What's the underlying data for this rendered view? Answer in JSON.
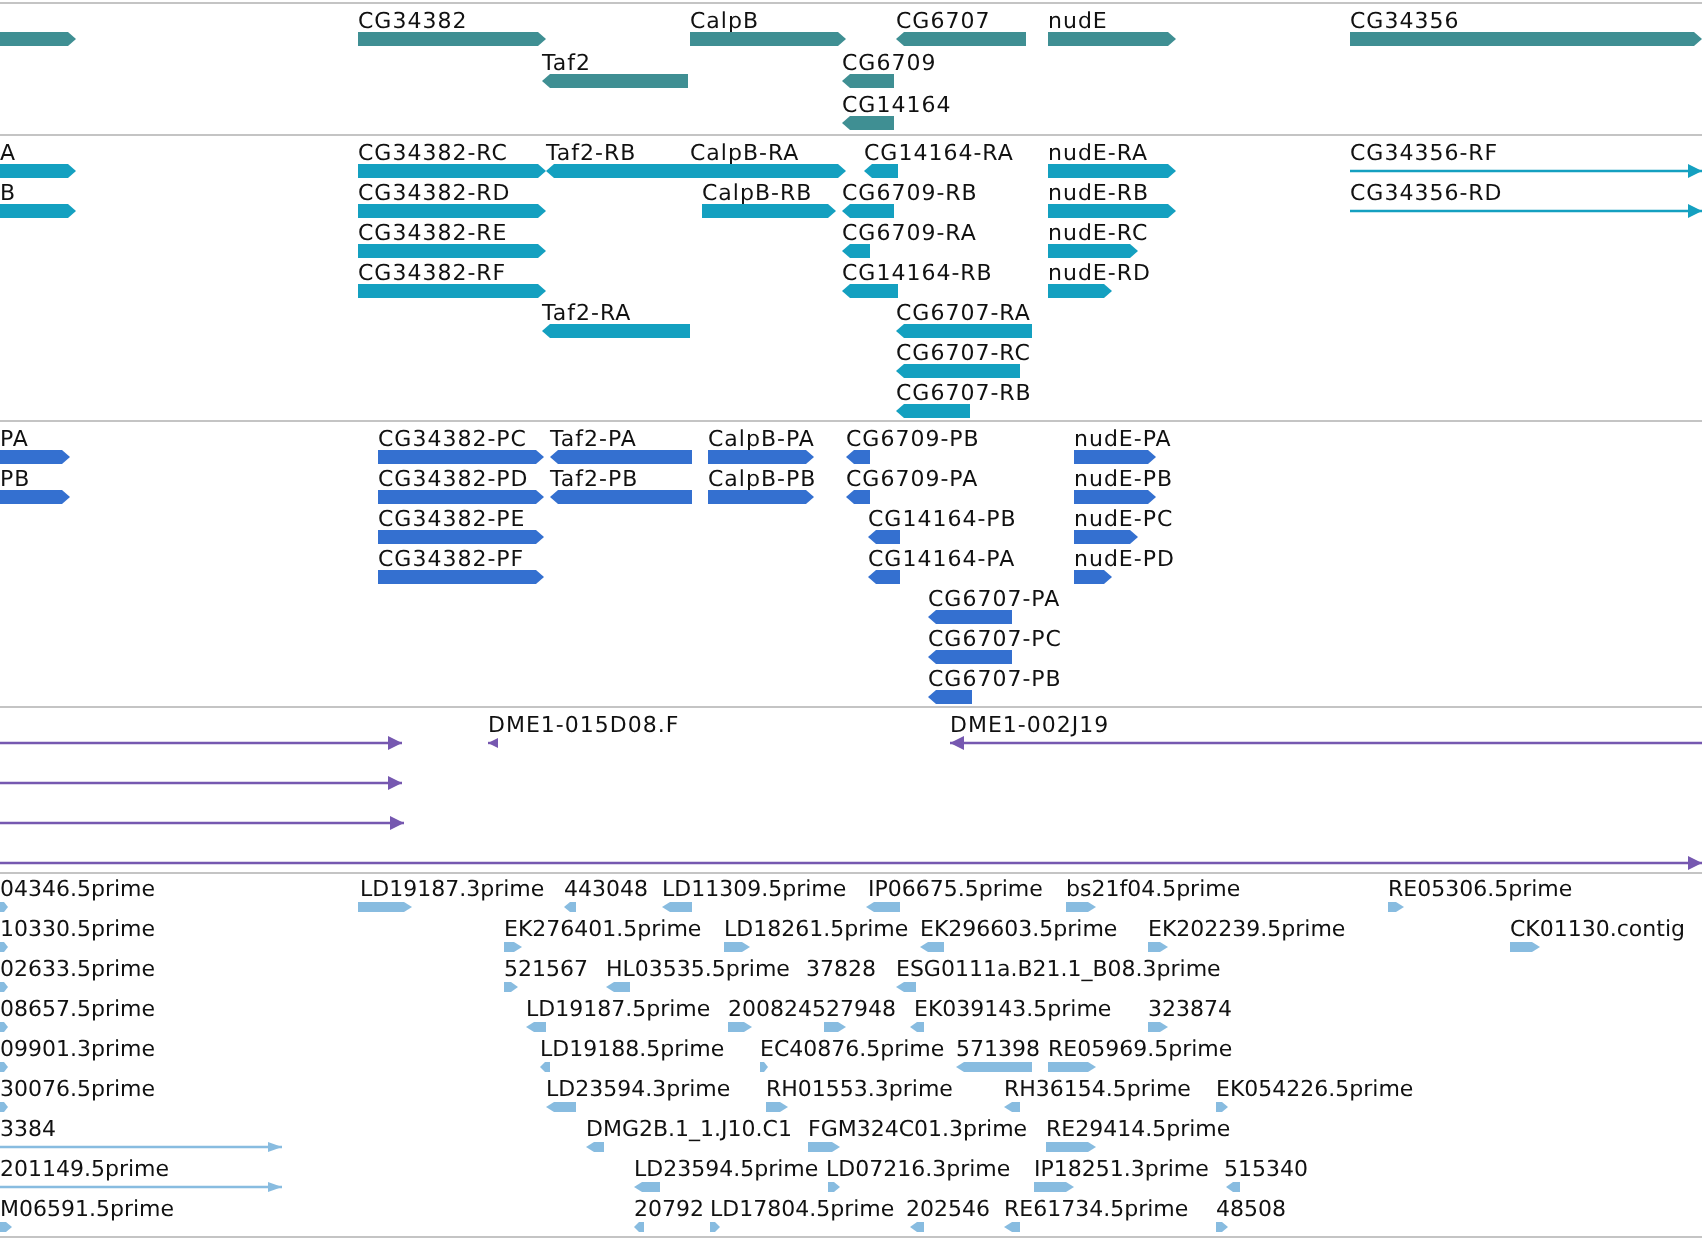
{
  "tracks": [
    {
      "kind": "gene",
      "color": "#3f8f93",
      "rows": [
        {
          "features": [
            {
              "reverse": false
            },
            {
              "label": "CG34382",
              "reverse": false
            },
            {
              "label": "CalpB",
              "reverse": false
            },
            {
              "label": "CG6707",
              "reverse": true
            },
            {
              "label": "nudE",
              "reverse": false
            },
            {
              "label": "CG34356",
              "reverse": false
            }
          ]
        },
        {
          "features": [
            {
              "label": "Taf2",
              "reverse": true
            },
            {
              "label": "CG6709",
              "reverse": true
            }
          ]
        },
        {
          "features": [
            {
              "label": "CG14164",
              "reverse": true
            }
          ]
        }
      ]
    },
    {
      "kind": "transcript",
      "color": "#14a0c0",
      "rows": [
        {
          "features": [
            {
              "label": "A",
              "reverse": false
            },
            {
              "label": "CG34382-RC",
              "reverse": false
            },
            {
              "label": "Taf2-RB",
              "reverse": true
            },
            {
              "label": "CalpB-RA",
              "reverse": false
            },
            {
              "label": "CG14164-RA",
              "reverse": true
            },
            {
              "label": "nudE-RA",
              "reverse": false
            },
            {
              "label": "CG34356-RF",
              "reverse": false
            }
          ]
        },
        {
          "features": [
            {
              "label": "B",
              "reverse": false
            },
            {
              "label": "CG34382-RD",
              "reverse": false
            },
            {
              "label": "CalpB-RB",
              "reverse": false
            },
            {
              "label": "CG6709-RB",
              "reverse": true
            },
            {
              "label": "nudE-RB",
              "reverse": false
            },
            {
              "label": "CG34356-RD",
              "reverse": false
            }
          ]
        },
        {
          "features": [
            {
              "label": "CG34382-RE",
              "reverse": false
            },
            {
              "label": "CG6709-RA",
              "reverse": true
            },
            {
              "label": "nudE-RC",
              "reverse": false
            }
          ]
        },
        {
          "features": [
            {
              "label": "CG34382-RF",
              "reverse": false
            },
            {
              "label": "CG14164-RB",
              "reverse": true
            },
            {
              "label": "nudE-RD",
              "reverse": false
            }
          ]
        },
        {
          "features": [
            {
              "label": "Taf2-RA",
              "reverse": true
            },
            {
              "label": "CG6707-RA",
              "reverse": true
            }
          ]
        },
        {
          "features": [
            {
              "label": "CG6707-RC",
              "reverse": true
            }
          ]
        },
        {
          "features": [
            {
              "label": "CG6707-RB",
              "reverse": true
            }
          ]
        }
      ]
    },
    {
      "kind": "protein",
      "color": "#3470d0",
      "rows": [
        {
          "features": [
            {
              "label": "PA",
              "reverse": false
            },
            {
              "label": "CG34382-PC",
              "reverse": false
            },
            {
              "label": "Taf2-PA",
              "reverse": true
            },
            {
              "label": "CalpB-PA",
              "reverse": false
            },
            {
              "label": "CG6709-PB",
              "reverse": true
            },
            {
              "label": "nudE-PA",
              "reverse": false
            }
          ]
        },
        {
          "features": [
            {
              "label": "PB",
              "reverse": false
            },
            {
              "label": "CG34382-PD",
              "reverse": false
            },
            {
              "label": "Taf2-PB",
              "reverse": true
            },
            {
              "label": "CalpB-PB",
              "reverse": false
            },
            {
              "label": "CG6709-PA",
              "reverse": true
            },
            {
              "label": "nudE-PB",
              "reverse": false
            }
          ]
        },
        {
          "features": [
            {
              "label": "CG34382-PE",
              "reverse": false
            },
            {
              "label": "CG14164-PB",
              "reverse": true
            },
            {
              "label": "nudE-PC",
              "reverse": false
            }
          ]
        },
        {
          "features": [
            {
              "label": "CG34382-PF",
              "reverse": false
            },
            {
              "label": "CG14164-PA",
              "reverse": true
            },
            {
              "label": "nudE-PD",
              "reverse": false
            }
          ]
        },
        {
          "features": [
            {
              "label": "CG6707-PA",
              "reverse": true
            }
          ]
        },
        {
          "features": [
            {
              "label": "CG6707-PC",
              "reverse": true
            }
          ]
        },
        {
          "features": [
            {
              "label": "CG6707-PB",
              "reverse": true
            }
          ]
        }
      ]
    },
    {
      "kind": "clone",
      "color": "#7658b0",
      "rows": [
        {
          "features": [
            {
              "reverse": false
            },
            {
              "label": "DME1-015D08.F",
              "reverse": true
            },
            {
              "label": "DME1-002J19",
              "reverse": true
            }
          ]
        },
        {
          "features": [
            {
              "reverse": false
            }
          ]
        },
        {
          "features": [
            {
              "reverse": false
            }
          ]
        },
        {
          "features": [
            {
              "reverse": false
            }
          ]
        }
      ]
    },
    {
      "kind": "est",
      "color": "#88bce0",
      "rows": [
        {
          "features": [
            {
              "label": "04346.5prime",
              "reverse": false
            },
            {
              "label": "LD19187.3prime",
              "reverse": false
            },
            {
              "label": "443048",
              "reverse": true
            },
            {
              "label": "LD11309.5prime",
              "reverse": true
            },
            {
              "label": "IP06675.5prime",
              "reverse": true
            },
            {
              "label": "bs21f04.5prime",
              "reverse": false
            },
            {
              "label": "RE05306.5prime",
              "reverse": false
            }
          ]
        },
        {
          "features": [
            {
              "label": "10330.5prime",
              "reverse": false
            },
            {
              "label": "EK276401.5prime",
              "reverse": false
            },
            {
              "label": "LD18261.5prime",
              "reverse": false
            },
            {
              "label": "EK296603.5prime",
              "reverse": true
            },
            {
              "label": "EK202239.5prime",
              "reverse": false
            },
            {
              "label": "CK01130.contig",
              "reverse": false
            }
          ]
        },
        {
          "features": [
            {
              "label": "02633.5prime",
              "reverse": false
            },
            {
              "label": "521567",
              "reverse": false
            },
            {
              "label": "HL03535.5prime",
              "reverse": true
            },
            {
              "label": "37828"
            },
            {
              "label": "ESG0111a.B21.1_B08.3prime",
              "reverse": true
            }
          ]
        },
        {
          "features": [
            {
              "label": "08657.5prime",
              "reverse": false
            },
            {
              "label": "LD19187.5prime",
              "reverse": true
            },
            {
              "label": "200824",
              "reverse": false
            },
            {
              "label": "527948",
              "reverse": false
            },
            {
              "label": "EK039143.5prime",
              "reverse": true
            },
            {
              "label": "323874",
              "reverse": false
            }
          ]
        },
        {
          "features": [
            {
              "label": "09901.3prime",
              "reverse": false
            },
            {
              "label": "LD19188.5prime",
              "reverse": true
            },
            {
              "label": "EC40876.5prime",
              "reverse": false
            },
            {
              "label": "571398",
              "reverse": true
            },
            {
              "label": "RE05969.5prime",
              "reverse": false
            }
          ]
        },
        {
          "features": [
            {
              "label": "30076.5prime",
              "reverse": false
            },
            {
              "label": "LD23594.3prime",
              "reverse": true
            },
            {
              "label": "RH01553.3prime",
              "reverse": false
            },
            {
              "label": "RH36154.5prime",
              "reverse": true
            },
            {
              "label": "EK054226.5prime",
              "reverse": false
            }
          ]
        },
        {
          "features": [
            {
              "label": "3384",
              "reverse": false
            },
            {
              "label": "DMG2B.1_1.J10.C1",
              "reverse": true
            },
            {
              "label": "FGM324C01.3prime",
              "reverse": false
            },
            {
              "label": "RE29414.5prime",
              "reverse": false
            }
          ]
        },
        {
          "features": [
            {
              "label": "201149.5prime",
              "reverse": false
            },
            {
              "label": "LD23594.5prime",
              "reverse": true
            },
            {
              "label": "LD07216.3prime",
              "reverse": false
            },
            {
              "label": "IP18251.3prime",
              "reverse": false
            },
            {
              "label": "515340",
              "reverse": true
            }
          ]
        },
        {
          "features": [
            {
              "label": "M06591.5prime",
              "reverse": false
            },
            {
              "label": "20792",
              "reverse": true
            },
            {
              "label": "LD17804.5prime",
              "reverse": false
            },
            {
              "label": "202546",
              "reverse": true
            },
            {
              "label": "RE61734.5prime",
              "reverse": true
            },
            {
              "label": "48508",
              "reverse": false
            }
          ]
        }
      ]
    }
  ]
}
